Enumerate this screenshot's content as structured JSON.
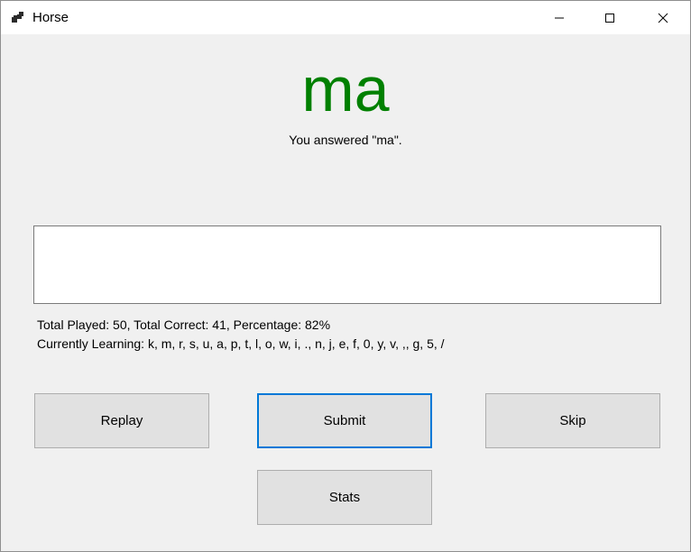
{
  "window": {
    "title": "Horse",
    "icon": "app-windows-icon",
    "controls": [
      "minimize-icon",
      "maximize-icon",
      "close-icon"
    ]
  },
  "main": {
    "big_answer": "ma",
    "big_answer_color": "#008000",
    "answer_message": "You answered \"ma\".",
    "input_value": "",
    "stats_line": "Total Played: 50, Total Correct: 41, Percentage: 82%",
    "learning_line": "Currently Learning: k, m, r, s, u, a, p, t, l, o, w, i, ., n, j, e, f, 0, y, v, ,, g, 5, /"
  },
  "buttons": {
    "replay": "Replay",
    "submit": "Submit",
    "skip": "Skip",
    "stats": "Stats"
  },
  "colors": {
    "focus_border": "#0078d7",
    "button_bg": "#e1e1e1",
    "window_bg": "#f0f0f0"
  }
}
